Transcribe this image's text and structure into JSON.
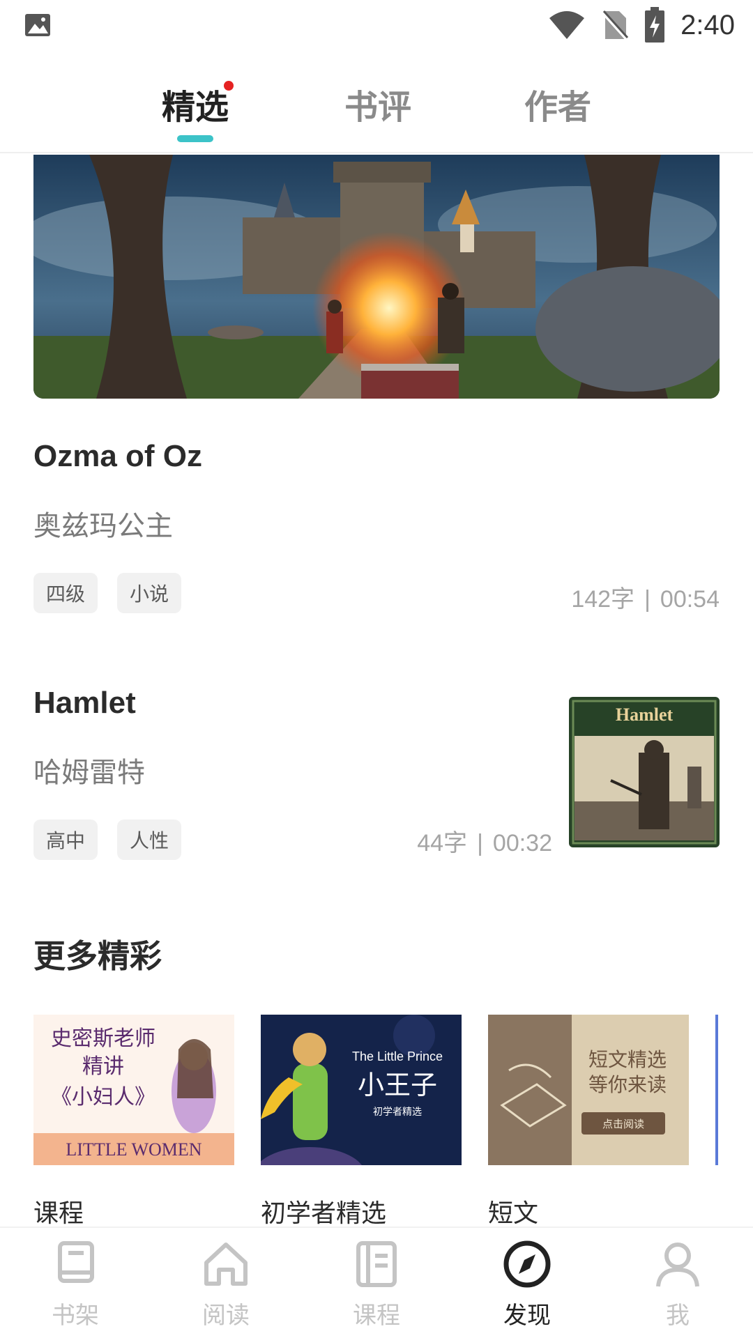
{
  "status_bar": {
    "time": "2:40"
  },
  "top_tabs": [
    {
      "label": "精选",
      "active": true,
      "has_dot": true
    },
    {
      "label": "书评",
      "active": false
    },
    {
      "label": "作者",
      "active": false
    }
  ],
  "articles": [
    {
      "title": "Ozma of Oz",
      "subtitle": "奥兹玛公主",
      "tags": [
        "四级",
        "小说"
      ],
      "words": "142字",
      "duration": "00:54"
    },
    {
      "title": "Hamlet",
      "subtitle": "哈姆雷特",
      "tags": [
        "高中",
        "人性"
      ],
      "words": "44字",
      "duration": "00:32",
      "thumb_text": "Hamlet"
    }
  ],
  "more_section": {
    "title": "更多精彩",
    "cards": [
      {
        "label": "课程",
        "img_text_1": "史密斯老师",
        "img_text_2": "精讲",
        "img_text_3": "《小妇人》",
        "img_text_4": "LITTLE WOMEN"
      },
      {
        "label": "初学者精选",
        "img_text_1": "The Little Prince",
        "img_text_2": "小王子",
        "img_text_3": "初学者精选"
      },
      {
        "label": "短文",
        "img_text_1": "短文精选",
        "img_text_2": "等你来读",
        "img_text_3": "点击阅读"
      }
    ]
  },
  "bottom_nav": [
    {
      "label": "书架",
      "icon": "bookshelf-icon",
      "active": false
    },
    {
      "label": "阅读",
      "icon": "home-icon",
      "active": false
    },
    {
      "label": "课程",
      "icon": "course-icon",
      "active": false
    },
    {
      "label": "发现",
      "icon": "compass-icon",
      "active": true
    },
    {
      "label": "我",
      "icon": "user-icon",
      "active": false
    }
  ],
  "colors": {
    "accent": "#3cc3c8",
    "dot": "#e52222"
  }
}
